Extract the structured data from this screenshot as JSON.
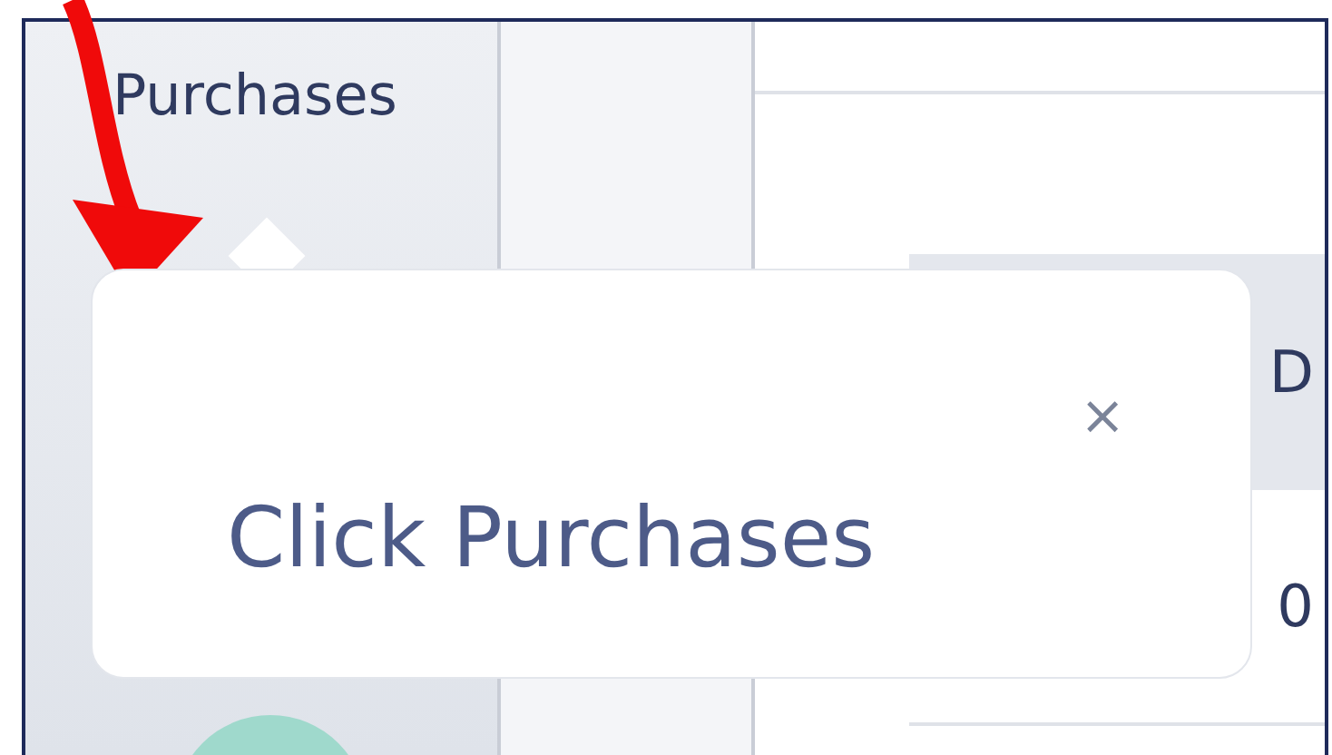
{
  "sidebar": {
    "items": [
      {
        "label": "Purchases"
      }
    ]
  },
  "table": {
    "columns": [
      {
        "label": "D"
      }
    ],
    "rows": [
      [
        "0"
      ]
    ]
  },
  "tooltip": {
    "text": "Click Purchases",
    "close": "×"
  }
}
